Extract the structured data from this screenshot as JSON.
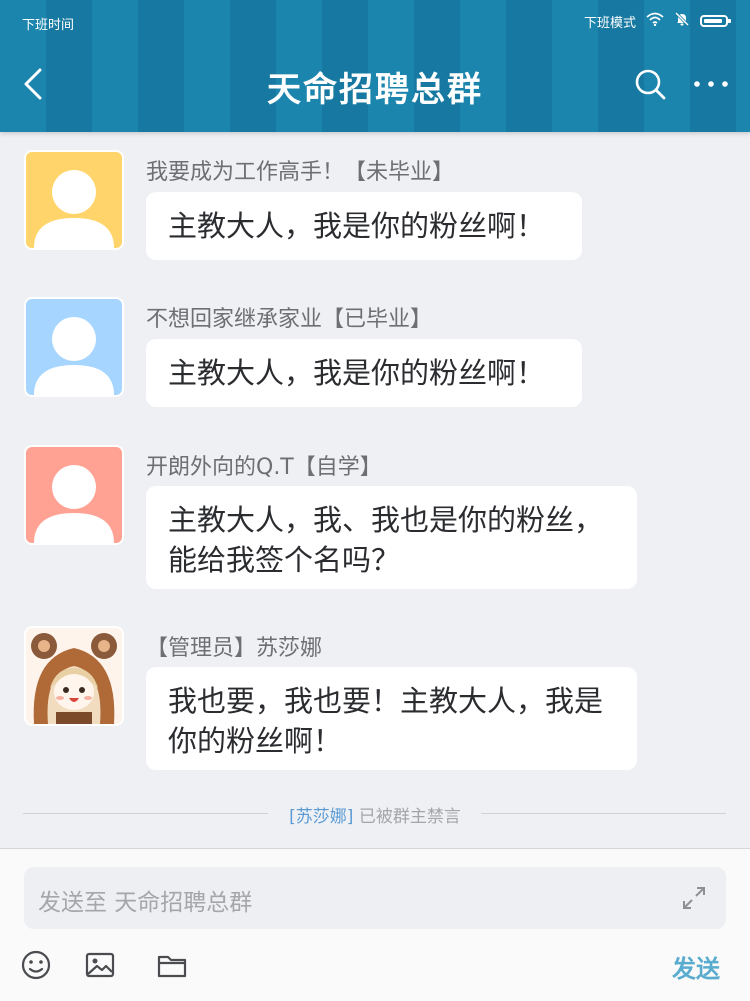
{
  "status_bar": {
    "carrier": "下班时间",
    "mode": "下班模式",
    "battery_level": 0.9,
    "icons": [
      "wifi-icon",
      "mute-icon",
      "battery-icon"
    ]
  },
  "header": {
    "title": "天命招聘总群",
    "back_icon": "back-arrow-icon",
    "search_icon": "search-icon",
    "more_icon": "more-dots-icon"
  },
  "messages": [
    {
      "sender": "我要成为工作高手！【未毕业】",
      "text": "主教大人，我是你的粉丝啊！",
      "avatar_color": "#ffd56b"
    },
    {
      "sender": "不想回家继承家业【已毕业】",
      "text": "主教大人，我是你的粉丝啊！",
      "avatar_color": "#a6d6ff"
    },
    {
      "sender": "开朗外向的Q.T【自学】",
      "text": "主教大人，我、我也是你的粉丝，能给我签个名吗？",
      "avatar_color": "#ffa293"
    },
    {
      "sender": "【管理员】苏莎娜",
      "text": "我也要，我也要！主教大人，我是你的粉丝啊！",
      "avatar_color": "#fff4ec"
    }
  ],
  "notice": {
    "name": "[苏莎娜]",
    "text": " 已被群主禁言"
  },
  "input": {
    "placeholder": "发送至  天命招聘总群"
  },
  "toolbar": {
    "send_label": "发送",
    "icons": [
      "emoji-icon",
      "image-icon",
      "folder-icon",
      "expand-icon"
    ]
  },
  "colors": {
    "header": "#1b85ae",
    "accent": "#5aaccf",
    "background": "#eff0f4"
  }
}
